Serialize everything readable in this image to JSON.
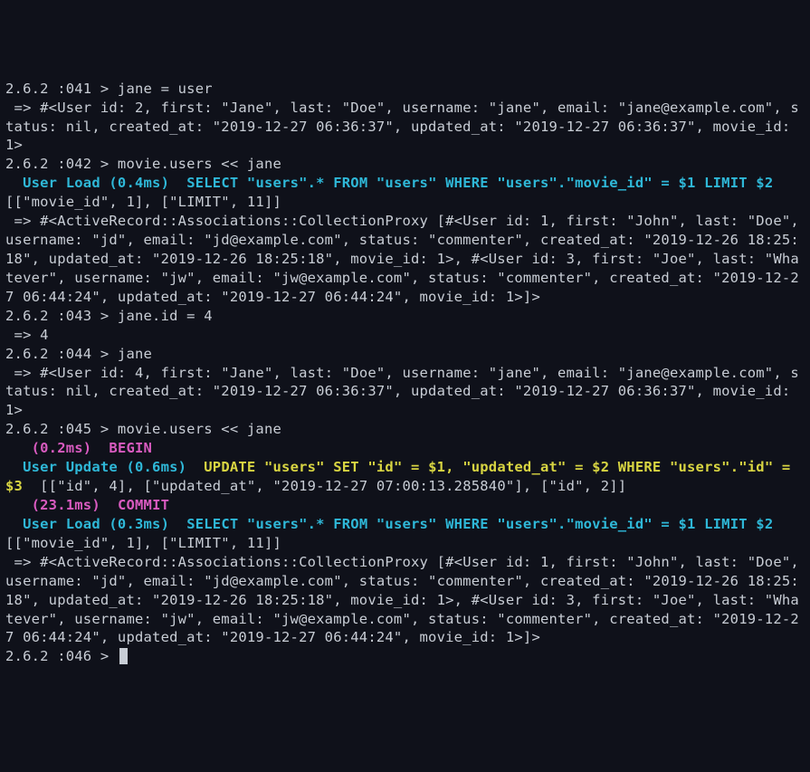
{
  "session": {
    "ruby_version": "2.6.2",
    "lines": {
      "l041_prompt": "2.6.2 :041 > jane = user",
      "l041_out": " => #<User id: 2, first: \"Jane\", last: \"Doe\", username: \"jane\", email: \"jane@example.com\", status: nil, created_at: \"2019-12-27 06:36:37\", updated_at: \"2019-12-27 06:36:37\", movie_id: 1>",
      "l042_prompt": "2.6.2 :042 > movie.users << jane",
      "l042_load_label": "  User Load (0.4ms)  ",
      "l042_load_sql": "SELECT \"users\".* FROM \"users\" WHERE \"users\".\"movie_id\" = $1 LIMIT $2",
      "l042_load_binds": "  [[\"movie_id\", 1], [\"LIMIT\", 11]]",
      "l042_out": " => #<ActiveRecord::Associations::CollectionProxy [#<User id: 1, first: \"John\", last: \"Doe\", username: \"jd\", email: \"jd@example.com\", status: \"commenter\", created_at: \"2019-12-26 18:25:18\", updated_at: \"2019-12-26 18:25:18\", movie_id: 1>, #<User id: 3, first: \"Joe\", last: \"Whatever\", username: \"jw\", email: \"jw@example.com\", status: \"commenter\", created_at: \"2019-12-27 06:44:24\", updated_at: \"2019-12-27 06:44:24\", movie_id: 1>]>",
      "l043_prompt": "2.6.2 :043 > jane.id = 4",
      "l043_out": " => 4",
      "l044_prompt": "2.6.2 :044 > jane",
      "l044_out": " => #<User id: 4, first: \"Jane\", last: \"Doe\", username: \"jane\", email: \"jane@example.com\", status: nil, created_at: \"2019-12-27 06:36:37\", updated_at: \"2019-12-27 06:36:37\", movie_id: 1>",
      "l045_prompt": "2.6.2 :045 > movie.users << jane",
      "l045_begin_time": "   (0.2ms)  ",
      "l045_begin_kw": "BEGIN",
      "l045_update_label": "  User Update (0.6ms)  ",
      "l045_update_sql": "UPDATE \"users\" SET \"id\" = $1, \"updated_at\" = $2 WHERE \"users\".\"id\" = $3",
      "l045_update_binds": "  [[\"id\", 4], [\"updated_at\", \"2019-12-27 07:00:13.285840\"], [\"id\", 2]]",
      "l045_commit_time": "   (23.1ms)  ",
      "l045_commit_kw": "COMMIT",
      "l045_load_label": "  User Load (0.3ms)  ",
      "l045_load_sql": "SELECT \"users\".* FROM \"users\" WHERE \"users\".\"movie_id\" = $1 LIMIT $2",
      "l045_load_binds": "  [[\"movie_id\", 1], [\"LIMIT\", 11]]",
      "l045_out": " => #<ActiveRecord::Associations::CollectionProxy [#<User id: 1, first: \"John\", last: \"Doe\", username: \"jd\", email: \"jd@example.com\", status: \"commenter\", created_at: \"2019-12-26 18:25:18\", updated_at: \"2019-12-26 18:25:18\", movie_id: 1>, #<User id: 3, first: \"Joe\", last: \"Whatever\", username: \"jw\", email: \"jw@example.com\", status: \"commenter\", created_at: \"2019-12-27 06:44:24\", updated_at: \"2019-12-27 06:44:24\", movie_id: 1>]>",
      "l046_prompt": "2.6.2 :046 > "
    }
  }
}
